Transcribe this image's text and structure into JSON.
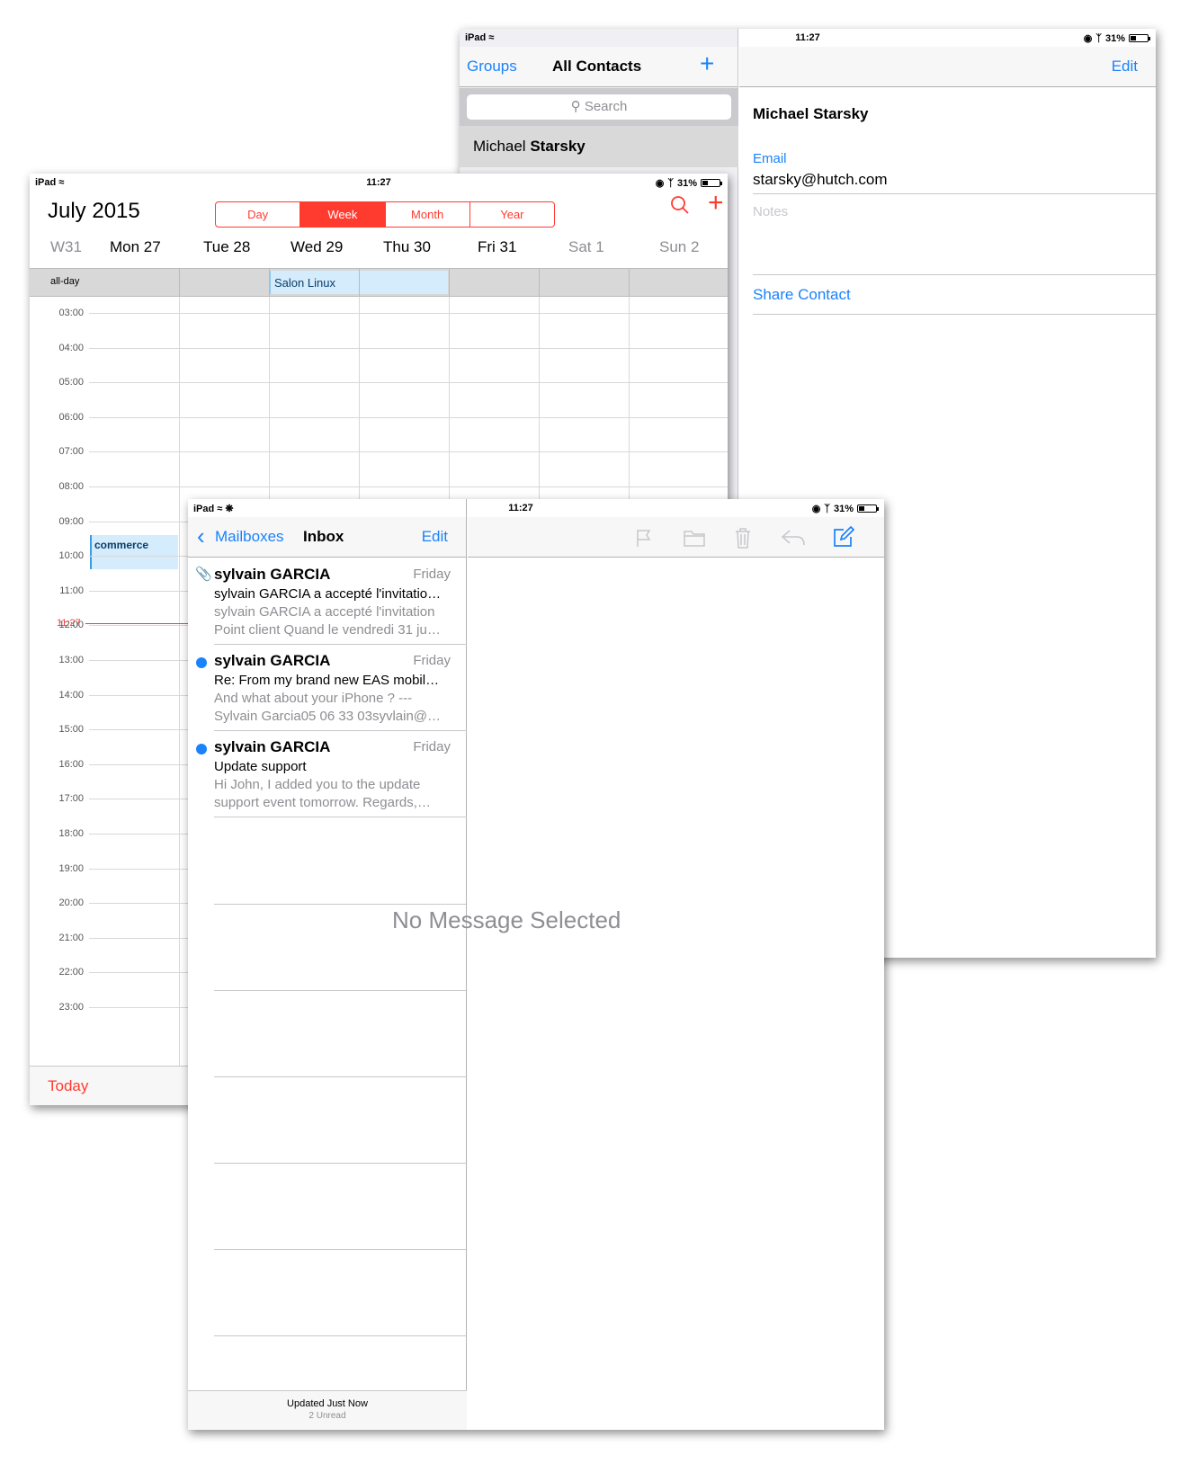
{
  "status": {
    "device": "iPad",
    "time": "11:27",
    "battery": "31%"
  },
  "contacts": {
    "groups_label": "Groups",
    "title": "All Contacts",
    "add_label": "+",
    "edit_label": "Edit",
    "search_placeholder": "Search",
    "selected_first": "Michael",
    "selected_last": "Starsky",
    "detail_name": "Michael Starsky",
    "email_label": "Email",
    "email_value": "starsky@hutch.com",
    "notes_label": "Notes",
    "share_label": "Share Contact"
  },
  "calendar": {
    "month": "July",
    "year": "2015",
    "segments": [
      "Day",
      "Week",
      "Month",
      "Year"
    ],
    "add_label": "+",
    "week_label": "W31",
    "days": [
      "Mon 27",
      "Tue 28",
      "Wed 29",
      "Thu 30",
      "Fri 31",
      "Sat 1",
      "Sun 2"
    ],
    "allday_label": "all-day",
    "allday_event": "Salon Linux",
    "hours": [
      "03:00",
      "04:00",
      "05:00",
      "06:00",
      "07:00",
      "08:00",
      "09:00",
      "10:00",
      "11:00",
      "12:00",
      "13:00",
      "14:00",
      "15:00",
      "16:00",
      "17:00",
      "18:00",
      "19:00",
      "20:00",
      "21:00",
      "22:00",
      "23:00"
    ],
    "now_label": "11:27",
    "event_label": "commerce",
    "today_label": "Today"
  },
  "mail": {
    "back_label": "Mailboxes",
    "title": "Inbox",
    "edit_label": "Edit",
    "messages": [
      {
        "from": "sylvain GARCIA",
        "date": "Friday",
        "subject": "sylvain GARCIA a accepté l'invitatio…",
        "preview1": "sylvain GARCIA a accepté l'invitation",
        "preview2": "Point client Quand le vendredi 31 ju…"
      },
      {
        "from": "sylvain GARCIA",
        "date": "Friday",
        "subject": "Re: From my brand new EAS mobil…",
        "preview1": "And what about your iPhone ? ---",
        "preview2": "Sylvain Garcia05 06 33 03syvlain@…"
      },
      {
        "from": "sylvain GARCIA",
        "date": "Friday",
        "subject": "Update support",
        "preview1": "Hi John, I added you to the update",
        "preview2": "support event tomorrow. Regards,…"
      }
    ],
    "no_selection": "No Message Selected",
    "footer_updated": "Updated Just Now",
    "footer_unread": "2 Unread"
  }
}
